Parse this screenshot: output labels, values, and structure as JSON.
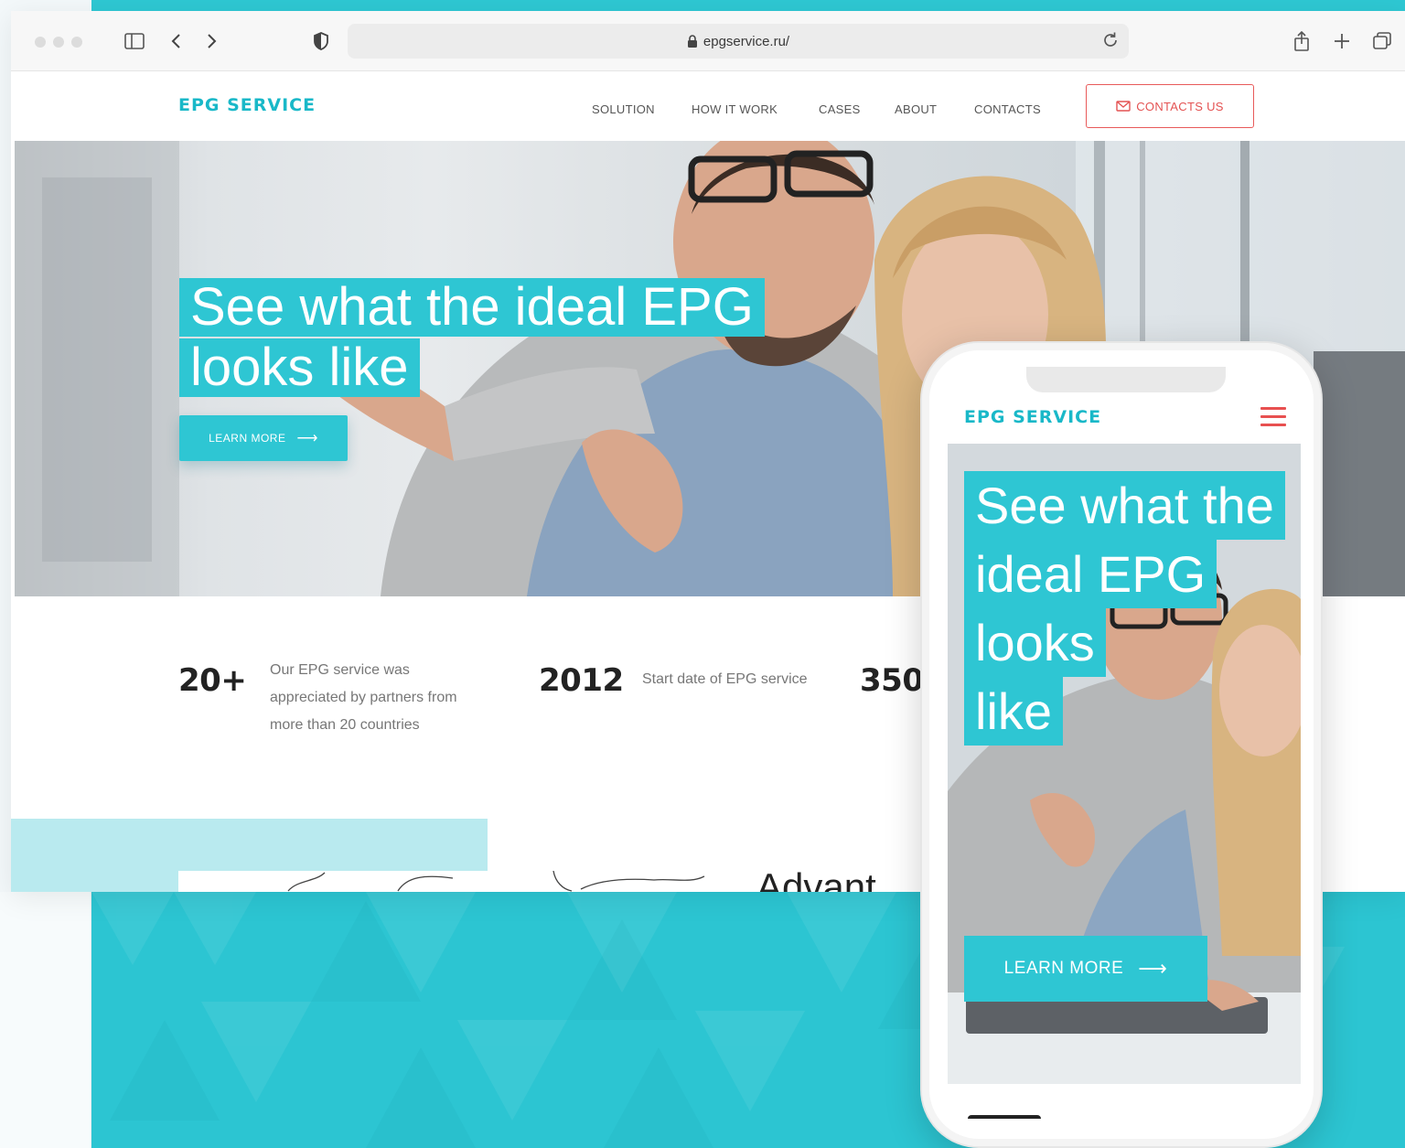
{
  "browser": {
    "url": "epgservice.ru/",
    "icons": [
      "sidebar-icon",
      "back-icon",
      "forward-icon",
      "shield-icon",
      "lock-icon",
      "reload-icon",
      "share-icon",
      "new-tab-icon",
      "tabs-overview-icon"
    ]
  },
  "site": {
    "logo": "EPG SERVICE",
    "nav": [
      "SOLUTION",
      "HOW IT WORK",
      "CASES",
      "ABOUT",
      "CONTACTS"
    ],
    "cta": "CONTACTS US"
  },
  "hero": {
    "title_line1": "See what the ideal EPG",
    "title_line2": "looks like",
    "button": "LEARN MORE"
  },
  "stats": [
    {
      "number": "20+",
      "text_lines": [
        "Our EPG service was",
        "appreciated by partners from",
        "more than 20 countries"
      ]
    },
    {
      "number": "2012",
      "text": "Start date of EPG service"
    },
    {
      "number": "350"
    }
  ],
  "next_section": {
    "heading_peek": "Advant"
  },
  "mobile": {
    "logo": "EPG SERVICE",
    "title_lines": [
      "See what the",
      "ideal EPG",
      "looks",
      "like"
    ],
    "button": "LEARN MORE"
  },
  "colors": {
    "accent": "#2ec6d3",
    "logo": "#19b8c8",
    "cta_red": "#e85a5a",
    "text_dark": "#222222",
    "text_muted": "#777777"
  }
}
